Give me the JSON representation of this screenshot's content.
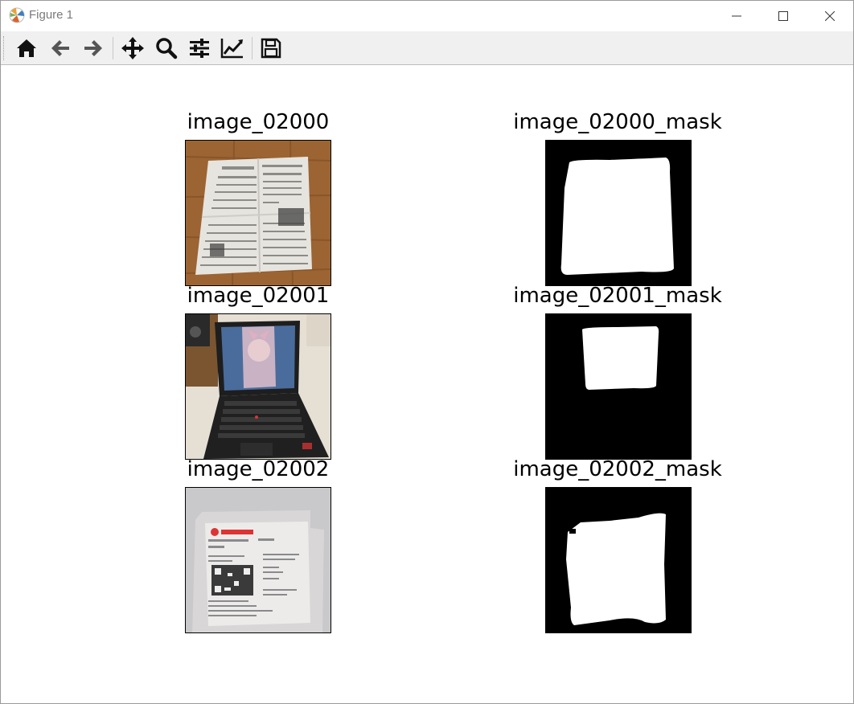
{
  "window": {
    "title": "Figure 1"
  },
  "toolbar": {
    "buttons": [
      {
        "name": "home-icon"
      },
      {
        "name": "back-arrow-icon"
      },
      {
        "name": "forward-arrow-icon"
      },
      {
        "name": "pan-icon"
      },
      {
        "name": "zoom-icon"
      },
      {
        "name": "subplots-config-icon"
      },
      {
        "name": "edit-axis-icon"
      },
      {
        "name": "save-icon"
      }
    ]
  },
  "figure": {
    "subplots": [
      {
        "title": "image_02000",
        "content": "photo of newspaper on wooden table"
      },
      {
        "title": "image_02000_mask",
        "content": "binary mask"
      },
      {
        "title": "image_02001",
        "content": "photo of laptop"
      },
      {
        "title": "image_02001_mask",
        "content": "binary mask"
      },
      {
        "title": "image_02002",
        "content": "photo of printed ticket"
      },
      {
        "title": "image_02002_mask",
        "content": "binary mask"
      }
    ]
  }
}
